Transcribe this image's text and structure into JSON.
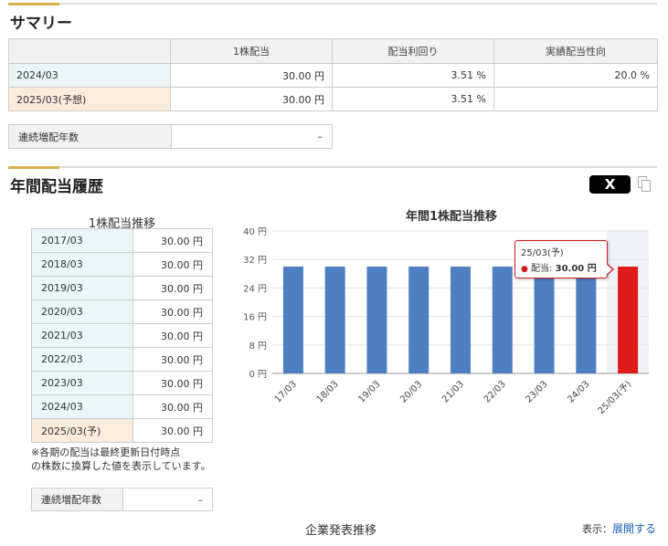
{
  "summary": {
    "title": "サマリー",
    "headers": [
      "",
      "1株配当",
      "配当利回り",
      "実績配当性向"
    ],
    "rows": [
      {
        "label": "2024/03",
        "dividend": "30.00 円",
        "yield": "3.51 %",
        "payout": "20.0 %"
      },
      {
        "label": "2025/03(予想)",
        "dividend": "30.00 円",
        "yield": "3.51 %",
        "payout": ""
      }
    ],
    "streak_label": "連続増配年数",
    "streak_value": "–"
  },
  "history": {
    "title": "年間配当履歴",
    "share_label": "X",
    "table_title": "1株配当推移",
    "rows": [
      {
        "label": "2017/03",
        "value": "30.00 円"
      },
      {
        "label": "2018/03",
        "value": "30.00 円"
      },
      {
        "label": "2019/03",
        "value": "30.00 円"
      },
      {
        "label": "2020/03",
        "value": "30.00 円"
      },
      {
        "label": "2021/03",
        "value": "30.00 円"
      },
      {
        "label": "2022/03",
        "value": "30.00 円"
      },
      {
        "label": "2023/03",
        "value": "30.00 円"
      },
      {
        "label": "2024/03",
        "value": "30.00 円"
      },
      {
        "label": "2025/03(予)",
        "value": "30.00 円"
      }
    ],
    "note_line1": "※各期の配当は最終更新日付時点",
    "note_line2": "の株数に換算した値を表示しています。",
    "streak_label": "連続増配年数",
    "streak_value": "–"
  },
  "tooltip": {
    "category": "25/03(予)",
    "label": "配当:",
    "value": "30.00 円"
  },
  "chart_data": {
    "type": "bar",
    "title": "年間1株配当推移",
    "categories": [
      "17/03",
      "18/03",
      "19/03",
      "20/03",
      "21/03",
      "22/03",
      "23/03",
      "24/03",
      "25/03(予)"
    ],
    "values": [
      30,
      30,
      30,
      30,
      30,
      30,
      30,
      30,
      30
    ],
    "yticks": [
      "0 円",
      "8 円",
      "16 円",
      "24 円",
      "32 円",
      "40 円"
    ],
    "ylim": [
      0,
      40
    ],
    "grid": true,
    "colors": {
      "actual": "#4e7fc0",
      "forecast": "#e01b1b",
      "highlight_band": "#eef2f8"
    }
  },
  "footer": {
    "title": "企業発表推移",
    "display_label": "表示：",
    "expand_link": "展開する"
  }
}
